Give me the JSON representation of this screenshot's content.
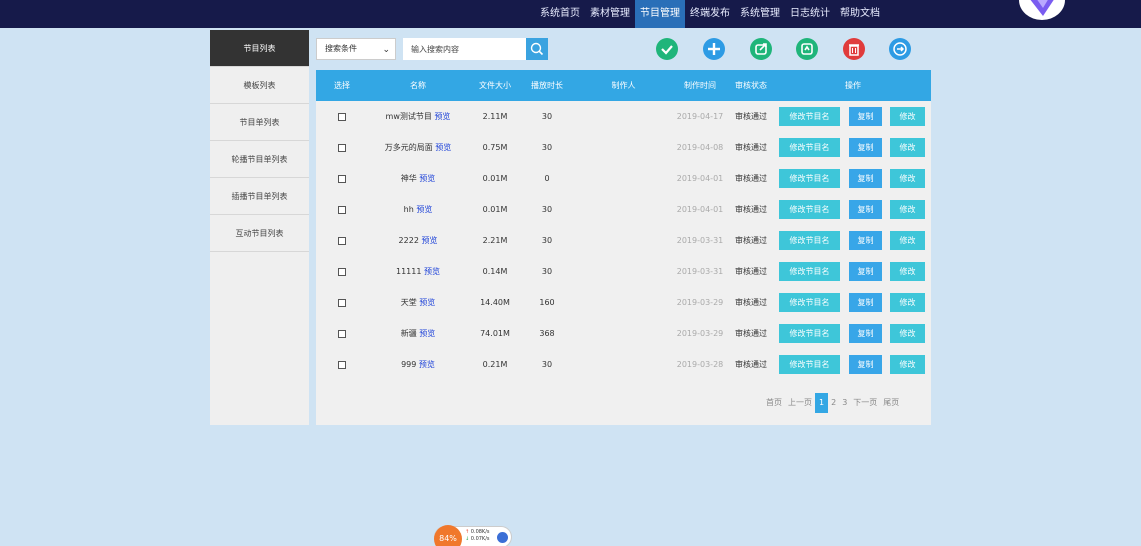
{
  "top_nav": {
    "items": [
      {
        "label": "系统首页",
        "active": false
      },
      {
        "label": "素材管理",
        "active": false
      },
      {
        "label": "节目管理",
        "active": true
      },
      {
        "label": "终端发布",
        "active": false
      },
      {
        "label": "系统管理",
        "active": false
      },
      {
        "label": "日志统计",
        "active": false
      },
      {
        "label": "帮助文档",
        "active": false
      }
    ]
  },
  "sidebar": {
    "items": [
      {
        "label": "节目列表",
        "active": true
      },
      {
        "label": "模板列表",
        "active": false
      },
      {
        "label": "节目单列表",
        "active": false
      },
      {
        "label": "轮播节目单列表",
        "active": false
      },
      {
        "label": "插播节目单列表",
        "active": false
      },
      {
        "label": "互动节目列表",
        "active": false
      }
    ]
  },
  "search": {
    "condition_label": "搜索条件",
    "placeholder": "输入搜索内容",
    "value": ""
  },
  "toolbar_icons": [
    {
      "name": "approve-icon",
      "color": "#1fb57a"
    },
    {
      "name": "add-icon",
      "color": "#2d9be4"
    },
    {
      "name": "share-icon",
      "color": "#1fb57a"
    },
    {
      "name": "refresh-icon",
      "color": "#1fb57a"
    },
    {
      "name": "delete-icon",
      "color": "#e03b3b"
    },
    {
      "name": "export-icon",
      "color": "#2d9be4"
    }
  ],
  "table": {
    "headers": [
      "选择",
      "名称",
      "文件大小",
      "播放时长",
      "制作人",
      "制作时间",
      "审核状态",
      "操作"
    ],
    "preview_label": "预览",
    "actions": {
      "rename": "修改节目名",
      "copy": "复制",
      "edit": "修改"
    },
    "rows": [
      {
        "name": "mw测试节目",
        "size": "2.11M",
        "duration": "30",
        "author": "",
        "date": "2019-04-17",
        "status": "审核通过"
      },
      {
        "name": "万多元的局面",
        "size": "0.75M",
        "duration": "30",
        "author": "",
        "date": "2019-04-08",
        "status": "审核通过"
      },
      {
        "name": "神华",
        "size": "0.01M",
        "duration": "0",
        "author": "",
        "date": "2019-04-01",
        "status": "审核通过"
      },
      {
        "name": "hh",
        "size": "0.01M",
        "duration": "30",
        "author": "",
        "date": "2019-04-01",
        "status": "审核通过"
      },
      {
        "name": "2222",
        "size": "2.21M",
        "duration": "30",
        "author": "",
        "date": "2019-03-31",
        "status": "审核通过"
      },
      {
        "name": "11111",
        "size": "0.14M",
        "duration": "30",
        "author": "",
        "date": "2019-03-31",
        "status": "审核通过"
      },
      {
        "name": "天堂",
        "size": "14.40M",
        "duration": "160",
        "author": "",
        "date": "2019-03-29",
        "status": "审核通过"
      },
      {
        "name": "新疆",
        "size": "74.01M",
        "duration": "368",
        "author": "",
        "date": "2019-03-29",
        "status": "审核通过"
      },
      {
        "name": "999",
        "size": "0.21M",
        "duration": "30",
        "author": "",
        "date": "2019-03-28",
        "status": "审核通过"
      }
    ]
  },
  "pagination": {
    "first": "首页",
    "prev": "上一页",
    "pages": [
      "1",
      "2",
      "3"
    ],
    "current": "1",
    "next": "下一页",
    "last": "尾页"
  },
  "widget": {
    "percent": "84%",
    "upload": "0.08K/s",
    "download": "0.07K/s"
  }
}
